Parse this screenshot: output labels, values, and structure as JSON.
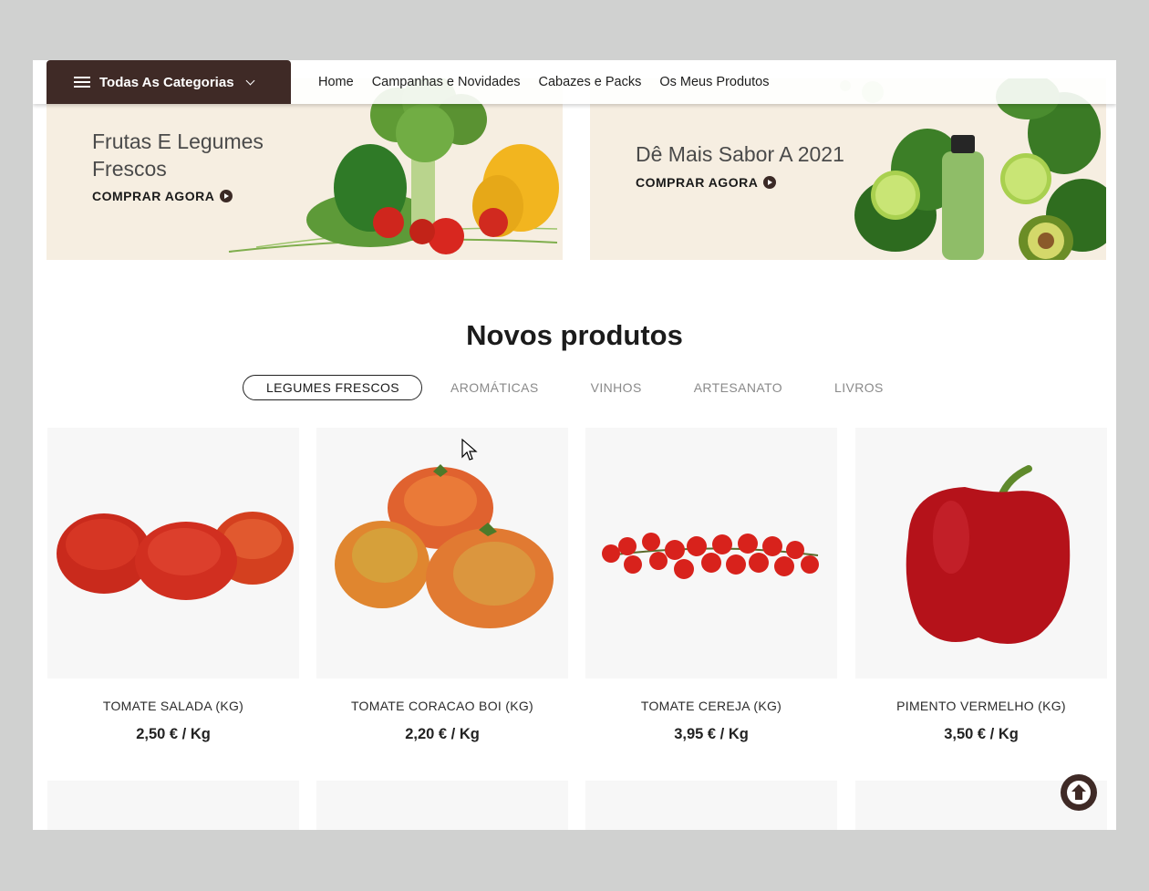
{
  "nav": {
    "categories_label": "Todas As Categorias",
    "links": [
      "Home",
      "Campanhas e Novidades",
      "Cabazes e Packs",
      "Os Meus Produtos"
    ]
  },
  "banners": [
    {
      "title": "Frutas E Legumes Frescos",
      "cta": "COMPRAR AGORA"
    },
    {
      "title": "Dê Mais Sabor A 2021",
      "cta": "COMPRAR AGORA"
    }
  ],
  "section": {
    "title": "Novos produtos",
    "tabs": [
      "LEGUMES FRESCOS",
      "AROMÁTICAS",
      "VINHOS",
      "ARTESANATO",
      "LIVROS"
    ],
    "active_tab": "LEGUMES FRESCOS"
  },
  "products": [
    {
      "name": "TOMATE SALADA (KG)",
      "price": "2,50 € / Kg"
    },
    {
      "name": "TOMATE CORACAO BOI (KG)",
      "price": "2,20 € / Kg"
    },
    {
      "name": "TOMATE CEREJA (KG)",
      "price": "3,95 € / Kg"
    },
    {
      "name": "PIMENTO VERMELHO (KG)",
      "price": "3,50 € / Kg"
    }
  ],
  "colors": {
    "brand": "#3f2a26",
    "banner_bg": "#f6eee1",
    "card_bg": "#f7f7f7"
  },
  "icons": {
    "menu": "hamburger-icon",
    "dropdown": "chevron-down-icon",
    "cta": "play-circle-icon",
    "back_to_top": "arrow-up-icon"
  }
}
